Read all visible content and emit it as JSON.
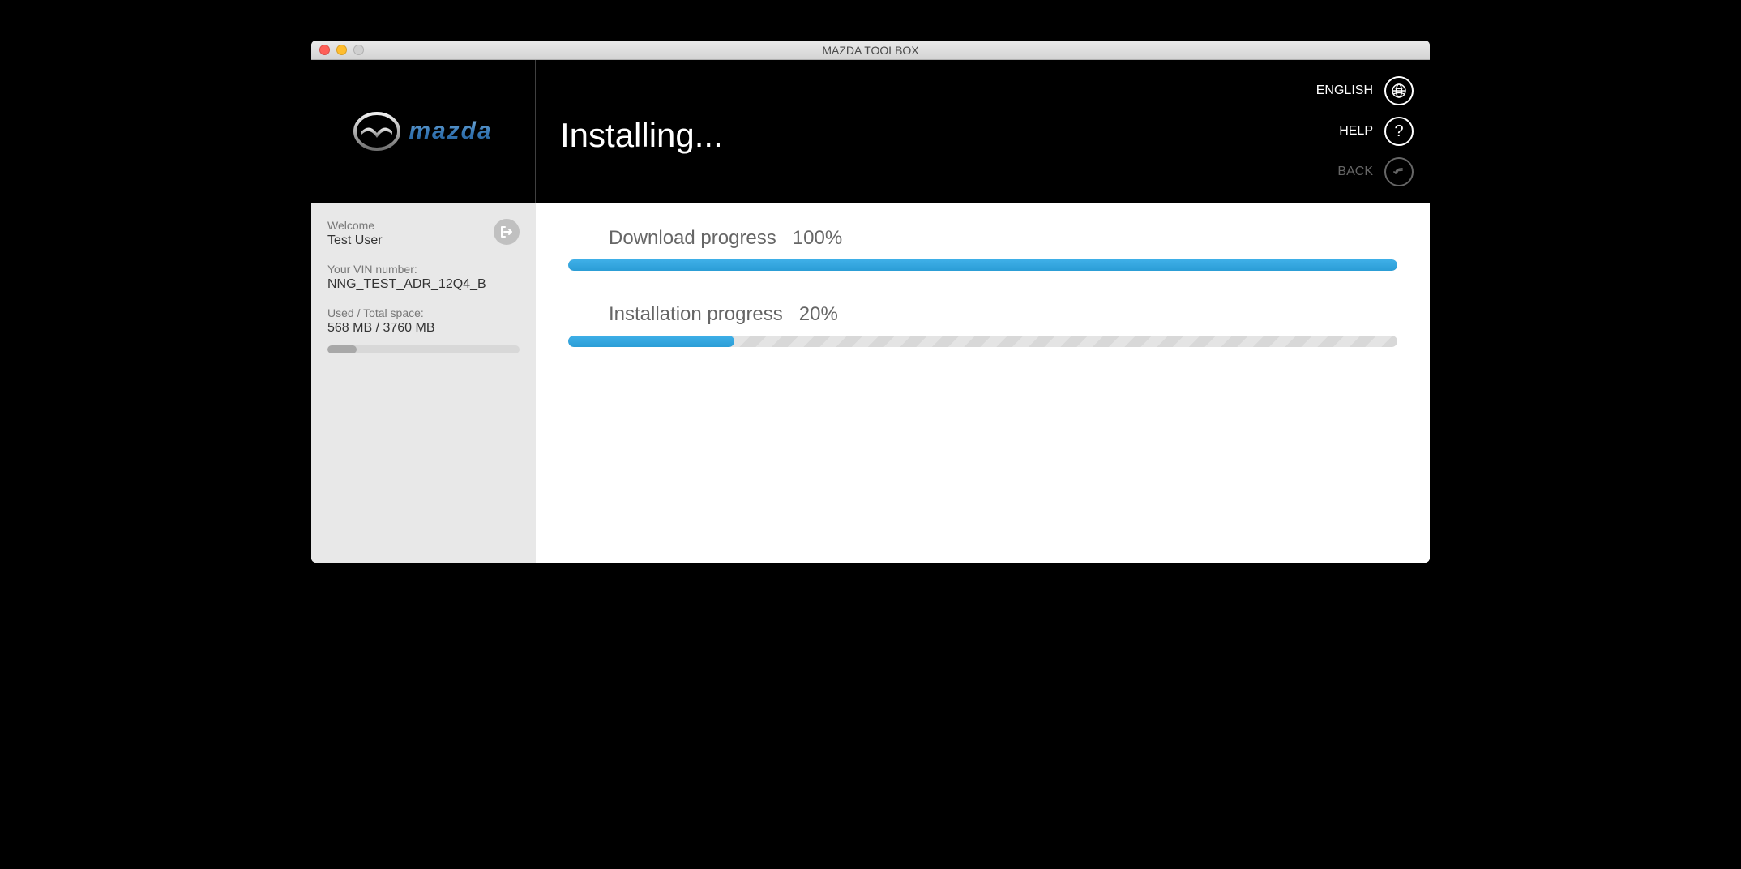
{
  "window": {
    "title": "MAZDA TOOLBOX"
  },
  "header": {
    "logo_text": "mazda",
    "page_title": "Installing...",
    "controls": {
      "language_label": "ENGLISH",
      "help_label": "HELP",
      "back_label": "BACK"
    }
  },
  "sidebar": {
    "welcome_label": "Welcome",
    "user_name": "Test User",
    "vin_label": "Your VIN number:",
    "vin_value": "NNG_TEST_ADR_12Q4_B",
    "space_label": "Used / Total space:",
    "space_value": "568 MB / 3760 MB",
    "storage_percent": 15
  },
  "main": {
    "download": {
      "label": "Download progress",
      "percent_text": "100%",
      "percent": 100
    },
    "installation": {
      "label": "Installation progress",
      "percent_text": "20%",
      "percent": 20
    }
  },
  "colors": {
    "accent": "#2b9dd6"
  }
}
